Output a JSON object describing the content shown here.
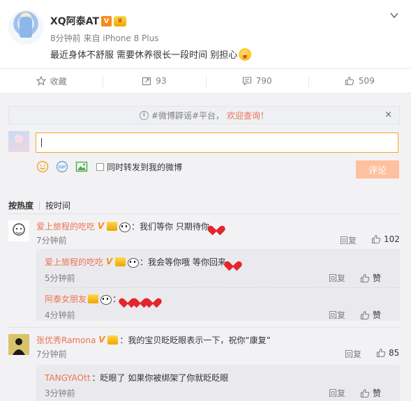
{
  "post": {
    "username": "XQ阿泰AT",
    "v_badge": "V",
    "meta": "8分钟前 来自 iPhone 8 Plus",
    "content": "最近身体不舒服 需要休养很长一段时间 别担心"
  },
  "actions": {
    "favorite": "收藏",
    "forward_count": "93",
    "comment_count": "790",
    "like_count": "509"
  },
  "notice": {
    "prefix": "#微博辟谣#平台，",
    "link": "欢迎查询！",
    "close": "×"
  },
  "composer": {
    "input_value": "",
    "repost_label": "同时转发到我的微博",
    "submit_label": "评论"
  },
  "sort": {
    "by_hot": "按热度",
    "by_time": "按时间"
  },
  "comments": [
    {
      "user": "爱上旅程的吃吃",
      "text": "：我们等你 只期待你",
      "time": "7分钟前",
      "reply": "回复",
      "likes": "102",
      "replies": [
        {
          "user": "爱上旅程的吃吃",
          "text": "：我会等你哦 等你回来",
          "time": "5分钟前",
          "reply": "回复",
          "likes": "赞"
        },
        {
          "user": "阿泰女朋友",
          "text": "：",
          "time": "4分钟前",
          "reply": "回复",
          "likes": "赞"
        }
      ]
    },
    {
      "user": "张优秀Ramona",
      "text": "：我的宝贝眨眨眼表示一下，祝你“康复”",
      "time": "7分钟前",
      "reply": "回复",
      "likes": "85",
      "replies": [
        {
          "user": "TANGYAOtt",
          "text": "：眨眼了 如果你被绑架了你就眨眨眼",
          "time": "3分钟前",
          "reply": "回复",
          "likes": "赞"
        }
      ]
    }
  ]
}
